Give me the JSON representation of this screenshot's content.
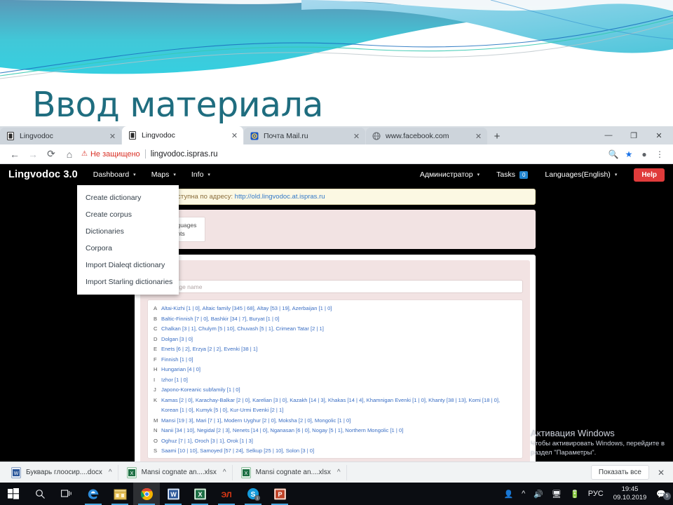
{
  "slide": {
    "title": "Ввод материала"
  },
  "browser": {
    "tabs": [
      {
        "title": "Lingvodoc",
        "favicon": "lingvodoc-icon",
        "active": false
      },
      {
        "title": "Lingvodoc",
        "favicon": "lingvodoc-icon",
        "active": true
      },
      {
        "title": "Почта Mail.ru",
        "favicon": "mailru-icon",
        "active": false
      },
      {
        "title": "www.facebook.com",
        "favicon": "globe-icon",
        "active": false
      }
    ],
    "tab_close_label": "✕",
    "new_tab_label": "+",
    "window_controls": {
      "minimize": "—",
      "maximize": "❐",
      "close": "✕"
    },
    "toolbar": {
      "back": "←",
      "forward": "→",
      "reload": "⟳",
      "home": "⌂",
      "security_warning": "Не защищено",
      "url": "lingvodoc.ispras.ru",
      "zoom_icon": "search-zoom-icon",
      "bookmark_icon": "star-icon",
      "profile_icon": "profile-icon",
      "menu_icon": "three-dot-menu-icon"
    }
  },
  "site": {
    "brand": "Lingvodoc 3.0",
    "nav_left": [
      {
        "label": "Dashboard",
        "caret": "▾"
      },
      {
        "label": "Maps",
        "caret": "▾"
      },
      {
        "label": "Info",
        "caret": "▾"
      }
    ],
    "nav_right": {
      "user": "Администратор",
      "user_caret": "▾",
      "tasks_label": "Tasks",
      "tasks_count": "0",
      "language": "Languages(English)",
      "language_caret": "▾",
      "help": "Help",
      "help_color": "#e03b3b"
    },
    "dropdown": {
      "items": [
        "Create dictionary",
        "Create corpus",
        "Dictionaries",
        "Corpora",
        "Import Dialeqt dictionary",
        "Import Starling dictionaries"
      ]
    },
    "alert": {
      "text": "системы доступна по адресу:",
      "link": "http://old.lingvodoc.at.ispras.ru"
    },
    "view_switch": {
      "options": [
        {
          "label": "By Languages",
          "selected": true
        },
        {
          "label": "By Grants",
          "selected": false
        }
      ]
    },
    "card": {
      "title": "uage",
      "search_placeholder": "ng language name"
    },
    "languages": [
      {
        "letter": "A",
        "names": "Altai-Kizhi [1 | 0], Altaic family [345 | 68], Altay [53 | 19], Azerbaijan [1 | 0]"
      },
      {
        "letter": "B",
        "names": "Baltic-Finnish [7 | 0], Bashkir [34 | 7], Buryat [1 | 0]"
      },
      {
        "letter": "C",
        "names": "Chalkan [3 | 1], Chulym [5 | 10], Chuvash [5 | 1], Crimean Tatar [2 | 1]"
      },
      {
        "letter": "D",
        "names": "Dolgan [3 | 0]"
      },
      {
        "letter": "E",
        "names": "Enets [6 | 2], Erzya [2 | 2], Evenki [38 | 1]"
      },
      {
        "letter": "F",
        "names": "Finnish [1 | 0]"
      },
      {
        "letter": "H",
        "names": "Hungarian [4 | 0]"
      },
      {
        "letter": "I",
        "names": "Izhor [1 | 0]"
      },
      {
        "letter": "J",
        "names": "Japono-Koreanic subfamily [1 | 0]"
      },
      {
        "letter": "K",
        "names": "Kamas [2 | 0], Karachay-Balkar [2 | 0], Karelian [3 | 0], Kazakh [14 | 3], Khakas [14 | 4], Khamnigan Evenki [1 | 0], Khanty [38 | 13], Komi [18 | 0], Korean [1 | 0], Kumyk [5 | 0], Kur-Urmi Evenki [2 | 1]"
      },
      {
        "letter": "M",
        "names": "Mansi [19 | 3], Mari [7 | 1], Modern Uyghur [2 | 0], Moksha [2 | 0], Mongolic [1 | 0]"
      },
      {
        "letter": "N",
        "names": "Nanii [34 | 10], Negidal [2 | 3], Nenets [14 | 0], Nganasan [6 | 0], Nogay [5 | 1], Northern Mongolic [1 | 0]"
      },
      {
        "letter": "O",
        "names": "Oghuz [7 | 1], Oroch [3 | 1], Orok [1 | 3]"
      },
      {
        "letter": "S",
        "names": "Saami [10 | 10], Samoyed [57 | 24], Selkup [25 | 10], Solon [3 | 0]"
      }
    ]
  },
  "activation": {
    "line1": "Активация Windows",
    "line2": "Чтобы активировать Windows, перейдите в",
    "line3": "раздел \"Параметры\"."
  },
  "downloads": {
    "items": [
      {
        "name": "Букварь глоосир....docx",
        "type": "word-doc-icon",
        "caret": "^"
      },
      {
        "name": "Mansi cognate an....xlsx",
        "type": "excel-doc-icon",
        "caret": "^"
      },
      {
        "name": "Mansi cognate an....xlsx",
        "type": "excel-doc-icon",
        "caret": "^"
      }
    ],
    "show_all": "Показать все",
    "close": "✕"
  },
  "taskbar": {
    "items": [
      {
        "name": "start-button",
        "icon": "windows-logo-icon"
      },
      {
        "name": "search-button",
        "icon": "search-icon"
      },
      {
        "name": "task-view-button",
        "icon": "task-view-icon"
      },
      {
        "name": "edge-button",
        "icon": "edge-icon"
      },
      {
        "name": "store-button",
        "icon": "store-icon"
      },
      {
        "name": "chrome-button",
        "icon": "chrome-icon"
      },
      {
        "name": "word-button",
        "icon": "word-icon"
      },
      {
        "name": "excel-button",
        "icon": "excel-icon"
      },
      {
        "name": "elan-button",
        "icon": "elan-icon"
      },
      {
        "name": "skype-button",
        "icon": "skype-icon",
        "badge": "1"
      },
      {
        "name": "powerpoint-button",
        "icon": "powerpoint-icon"
      }
    ],
    "tray": {
      "people": "people-icon",
      "chevron": "^",
      "volume": "volume-icon",
      "network": "network-icon",
      "battery": "battery-icon",
      "language": "РУС",
      "time": "19:45",
      "date": "09.10.2019",
      "notifications_count": "5"
    }
  }
}
